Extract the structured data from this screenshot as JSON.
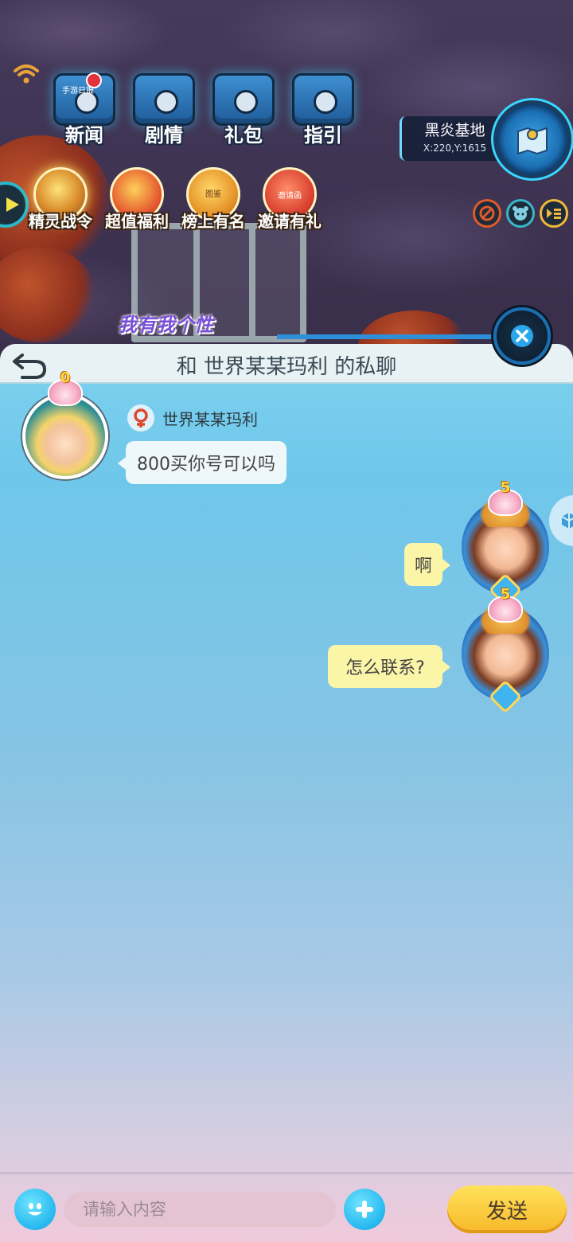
{
  "top_menu": [
    {
      "label": "新闻",
      "icon": "news-tv-icon"
    },
    {
      "label": "剧情",
      "icon": "story-box-icon"
    },
    {
      "label": "礼包",
      "icon": "gift-chest-icon"
    },
    {
      "label": "指引",
      "icon": "guide-box-icon"
    }
  ],
  "news_art_text": "手游日报",
  "activities": [
    {
      "label": "精灵战令",
      "icon": "battle-pass-icon"
    },
    {
      "label": "超值福利",
      "icon": "welfare-gift-icon"
    },
    {
      "label": "榜上有名",
      "icon": "trophy-icon"
    },
    {
      "label": "邀请有礼",
      "icon": "invite-envelope-icon"
    }
  ],
  "trophy_art_text": "图鉴",
  "invite_art_text": "邀请函",
  "slogan": "我有我个性",
  "location": {
    "name": "黑炎基地",
    "coordinates": "X:220,Y:1615"
  },
  "chat": {
    "title": "和 世界某某玛利 的私聊",
    "partner_name": "世界某某玛利",
    "partner_gender": "female",
    "partner_vip": "0",
    "self_vip": "5",
    "messages": [
      {
        "side": "left",
        "text": "800买你号可以吗"
      },
      {
        "side": "right",
        "text": "啊"
      },
      {
        "side": "right",
        "text": "怎么联系?"
      }
    ]
  },
  "input": {
    "placeholder": "请输入内容",
    "value": ""
  },
  "send_label": "发送",
  "colors": {
    "accent_blue": "#25b8ef",
    "send_yellow": "#f7b82a",
    "self_bubble": "#fbf5a8",
    "partner_bubble": "#eef7fa"
  }
}
